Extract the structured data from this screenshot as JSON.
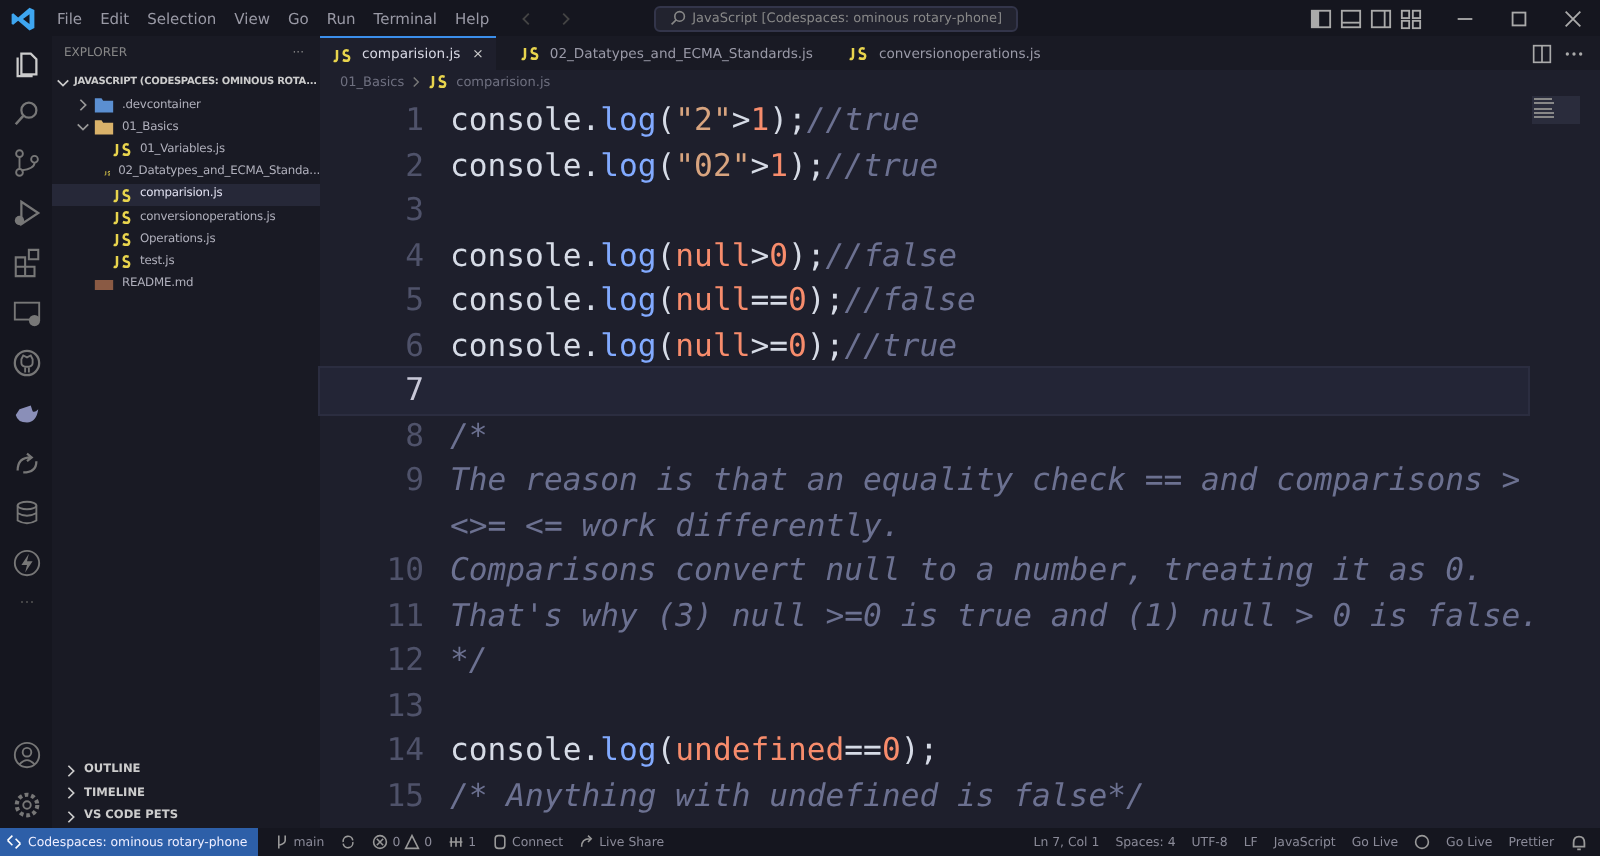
{
  "title_bar": {
    "menu": [
      "File",
      "Edit",
      "Selection",
      "View",
      "Go",
      "Run",
      "Terminal",
      "Help"
    ],
    "search": "JavaScript [Codespaces: ominous rotary-phone]"
  },
  "sidebar": {
    "title": "EXPLORER",
    "more": "···",
    "section": "JAVASCRIPT (CODESPACES: OMINOUS ROTA...",
    "tree": [
      {
        "label": ".devcontainer",
        "kind": "folder",
        "expanded": false,
        "selected": false
      },
      {
        "label": "01_Basics",
        "kind": "folder",
        "expanded": true,
        "selected": false,
        "children": [
          {
            "label": "01_Variables.js",
            "kind": "js",
            "selected": false
          },
          {
            "label": "02_Datatypes_and_ECMA_Standa...",
            "kind": "js",
            "selected": false
          },
          {
            "label": "comparision.js",
            "kind": "js",
            "selected": true
          },
          {
            "label": "conversionoperations.js",
            "kind": "js",
            "selected": false
          },
          {
            "label": "Operations.js",
            "kind": "js",
            "selected": false
          },
          {
            "label": "test.js",
            "kind": "js",
            "selected": false
          }
        ]
      },
      {
        "label": "README.md",
        "kind": "md",
        "selected": false
      }
    ],
    "panels": [
      "OUTLINE",
      "TIMELINE",
      "VS CODE PETS"
    ]
  },
  "tabs": [
    {
      "label": "comparision.js",
      "selected": true,
      "close": "×"
    },
    {
      "label": "02_Datatypes_and_ECMA_Standards.js",
      "selected": false
    },
    {
      "label": "conversionoperations.js",
      "selected": false
    }
  ],
  "breadcrumb": [
    "01_Basics",
    "comparision.js"
  ],
  "editor": {
    "lines": [
      {
        "number": "1",
        "current": false,
        "tokens": [
          {
            "kind": "plain",
            "text": "console."
          },
          {
            "kind": "fn",
            "text": "log"
          },
          {
            "kind": "plain",
            "text": "("
          },
          {
            "kind": "string",
            "text": "\"2\""
          },
          {
            "kind": "plain",
            "text": ">"
          },
          {
            "kind": "number",
            "text": "1"
          },
          {
            "kind": "plain",
            "text": ");"
          },
          {
            "kind": "comment",
            "text": "//true"
          }
        ]
      },
      {
        "number": "2",
        "current": false,
        "tokens": [
          {
            "kind": "plain",
            "text": "console."
          },
          {
            "kind": "fn",
            "text": "log"
          },
          {
            "kind": "plain",
            "text": "("
          },
          {
            "kind": "string",
            "text": "\"02\""
          },
          {
            "kind": "plain",
            "text": ">"
          },
          {
            "kind": "number",
            "text": "1"
          },
          {
            "kind": "plain",
            "text": ");"
          },
          {
            "kind": "comment",
            "text": "//true"
          }
        ]
      },
      {
        "number": "3",
        "current": false
      },
      {
        "number": "4",
        "current": false,
        "tokens": [
          {
            "kind": "plain",
            "text": "console."
          },
          {
            "kind": "fn",
            "text": "log"
          },
          {
            "kind": "plain",
            "text": "("
          },
          {
            "kind": "keyword",
            "text": "null"
          },
          {
            "kind": "plain",
            "text": ">"
          },
          {
            "kind": "number",
            "text": "0"
          },
          {
            "kind": "plain",
            "text": ");"
          },
          {
            "kind": "comment",
            "text": "//false"
          }
        ]
      },
      {
        "number": "5",
        "current": false,
        "tokens": [
          {
            "kind": "plain",
            "text": "console."
          },
          {
            "kind": "fn",
            "text": "log"
          },
          {
            "kind": "plain",
            "text": "("
          },
          {
            "kind": "keyword",
            "text": "null"
          },
          {
            "kind": "plain",
            "text": "=="
          },
          {
            "kind": "number",
            "text": "0"
          },
          {
            "kind": "plain",
            "text": ");"
          },
          {
            "kind": "comment",
            "text": "//false"
          }
        ]
      },
      {
        "number": "6",
        "current": false,
        "tokens": [
          {
            "kind": "plain",
            "text": "console."
          },
          {
            "kind": "fn",
            "text": "log"
          },
          {
            "kind": "plain",
            "text": "("
          },
          {
            "kind": "keyword",
            "text": "null"
          },
          {
            "kind": "plain",
            "text": ">="
          },
          {
            "kind": "number",
            "text": "0"
          },
          {
            "kind": "plain",
            "text": ");"
          },
          {
            "kind": "comment",
            "text": "//true"
          }
        ]
      },
      {
        "number": "7",
        "current": true
      },
      {
        "number": "8",
        "current": false,
        "tokens": [
          {
            "kind": "comment",
            "text": "/*"
          }
        ]
      },
      {
        "number": "9",
        "current": false,
        "tokens": [
          {
            "kind": "comment",
            "text": "The reason is that an equality check == and comparisons >"
          }
        ]
      },
      {
        "current": false,
        "tokens": [
          {
            "kind": "comment",
            "text": "<>= <= work differently."
          }
        ]
      },
      {
        "number": "10",
        "current": false,
        "tokens": [
          {
            "kind": "comment",
            "text": "Comparisons convert null to a number, treating it as 0."
          }
        ]
      },
      {
        "number": "11",
        "current": false,
        "tokens": [
          {
            "kind": "comment",
            "text": "That's why (3) null >=0 is true and (1) null > 0 is false."
          }
        ]
      },
      {
        "number": "12",
        "current": false,
        "tokens": [
          {
            "kind": "comment",
            "text": "*/"
          }
        ]
      },
      {
        "number": "13",
        "current": false
      },
      {
        "number": "14",
        "current": false,
        "tokens": [
          {
            "kind": "plain",
            "text": "console."
          },
          {
            "kind": "fn",
            "text": "log"
          },
          {
            "kind": "plain",
            "text": "("
          },
          {
            "kind": "keyword",
            "text": "undefined"
          },
          {
            "kind": "plain",
            "text": "=="
          },
          {
            "kind": "number",
            "text": "0"
          },
          {
            "kind": "plain",
            "text": ");"
          }
        ]
      },
      {
        "number": "15",
        "current": false,
        "tokens": [
          {
            "kind": "comment",
            "text": "/* Anything with undefined is false*/"
          }
        ]
      }
    ]
  },
  "status_bar": {
    "remote": "Codespaces: ominous rotary-phone",
    "branch": "main",
    "errors": "0",
    "warnings": "0",
    "ports": "1",
    "connect": "Connect",
    "live_share": "Live Share",
    "right": [
      "Ln 7, Col 1",
      "Spaces: 4",
      "UTF-8",
      "LF",
      "JavaScript",
      "Go Live",
      "Go Live",
      "Prettier"
    ]
  }
}
